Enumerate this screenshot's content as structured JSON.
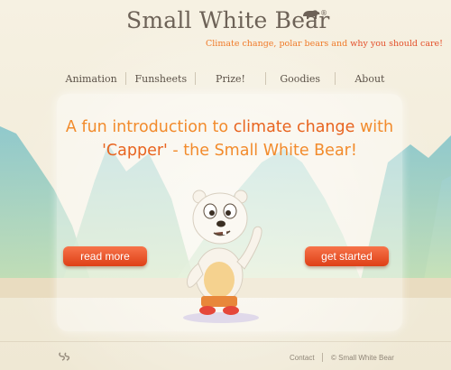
{
  "header": {
    "logo_text": "Small White Bear",
    "registered_mark": "®",
    "tagline_start": "Climate change, polar bears and ",
    "tagline_emphasis": "why you should care!"
  },
  "nav": {
    "items": [
      {
        "label": "Animation"
      },
      {
        "label": "Funsheets"
      },
      {
        "label": "Prize!"
      },
      {
        "label": "Goodies"
      },
      {
        "label": "About"
      }
    ]
  },
  "hero": {
    "line1_start": "A fun introduction to ",
    "line1_emphasis": "climate change",
    "line1_end": " with",
    "line2_start": "'Capper'",
    "line2_end": " - the Small White Bear!",
    "read_more_label": "read more",
    "get_started_label": "get started"
  },
  "footer": {
    "contact_label": "Contact",
    "copyright": "© Small White Bear"
  },
  "colors": {
    "accent_orange": "#f28b2c",
    "button_red": "#e2471b",
    "text_brown": "#6d6257"
  }
}
